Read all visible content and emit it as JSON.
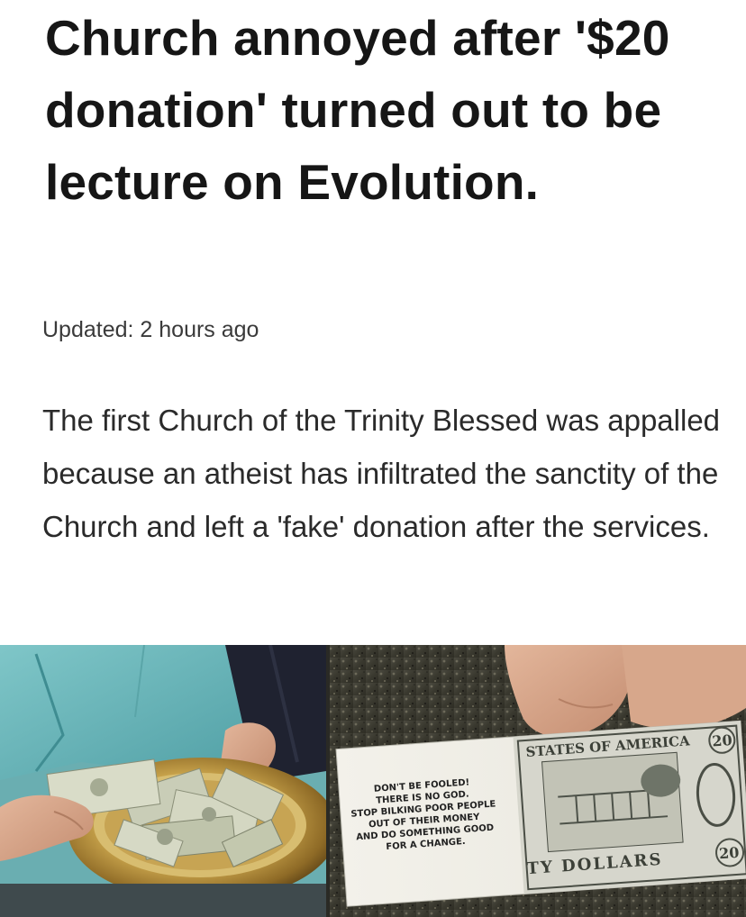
{
  "article": {
    "headline": "Church annoyed after '$20 donation' turned out to be lecture on Evolution.",
    "updated": "Updated: 2 hours ago",
    "body": "The first Church of the Trinity Blessed was appalled because an atheist has infiltrated the sanctity of the Church and left a 'fake' donation after the services."
  },
  "photo": {
    "bill_note_lines": [
      "DON'T BE FOOLED!",
      "THERE IS NO GOD.",
      "STOP BILKING POOR PEOPLE",
      "OUT OF THEIR MONEY",
      "AND DO SOMETHING GOOD",
      "FOR A CHANGE."
    ],
    "bill_top_text": "STATES OF AMERICA",
    "bill_bottom_text": "TY DOLLARS",
    "bill_denomination": "20"
  }
}
